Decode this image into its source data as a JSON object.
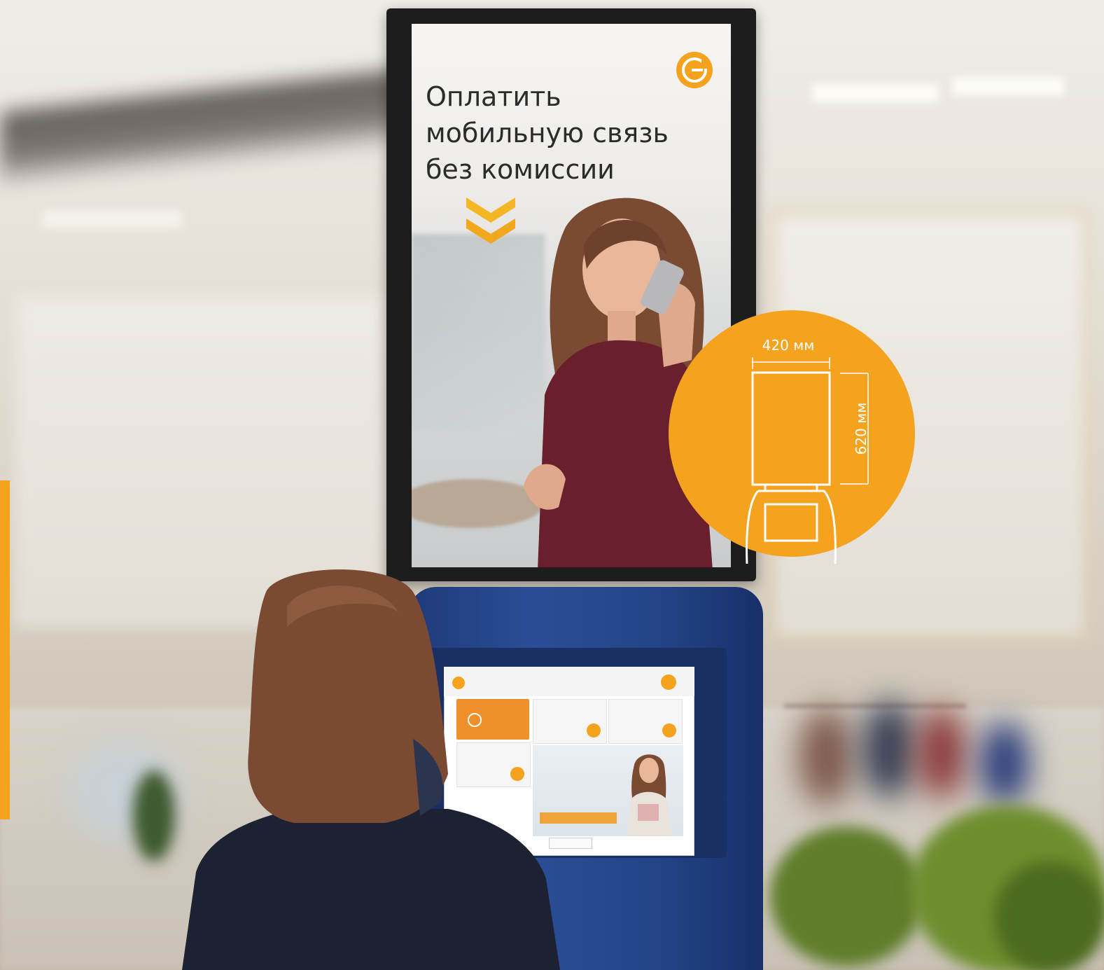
{
  "poster": {
    "headline": [
      "Оплатить",
      "мобильную связь",
      "без комиссии"
    ]
  },
  "dimensions": {
    "width_label": "420 мм",
    "height_label": "620 мм"
  },
  "colors": {
    "accent": "#f5a21f",
    "kiosk_blue": "#244487",
    "poster_frame": "#1e1d1e",
    "dress": "#6a1f2c",
    "hair": "#7a4a33"
  },
  "icons": {
    "poster_logo": "brand-logo-icon",
    "chevrons": "chevron-down-double-icon"
  }
}
